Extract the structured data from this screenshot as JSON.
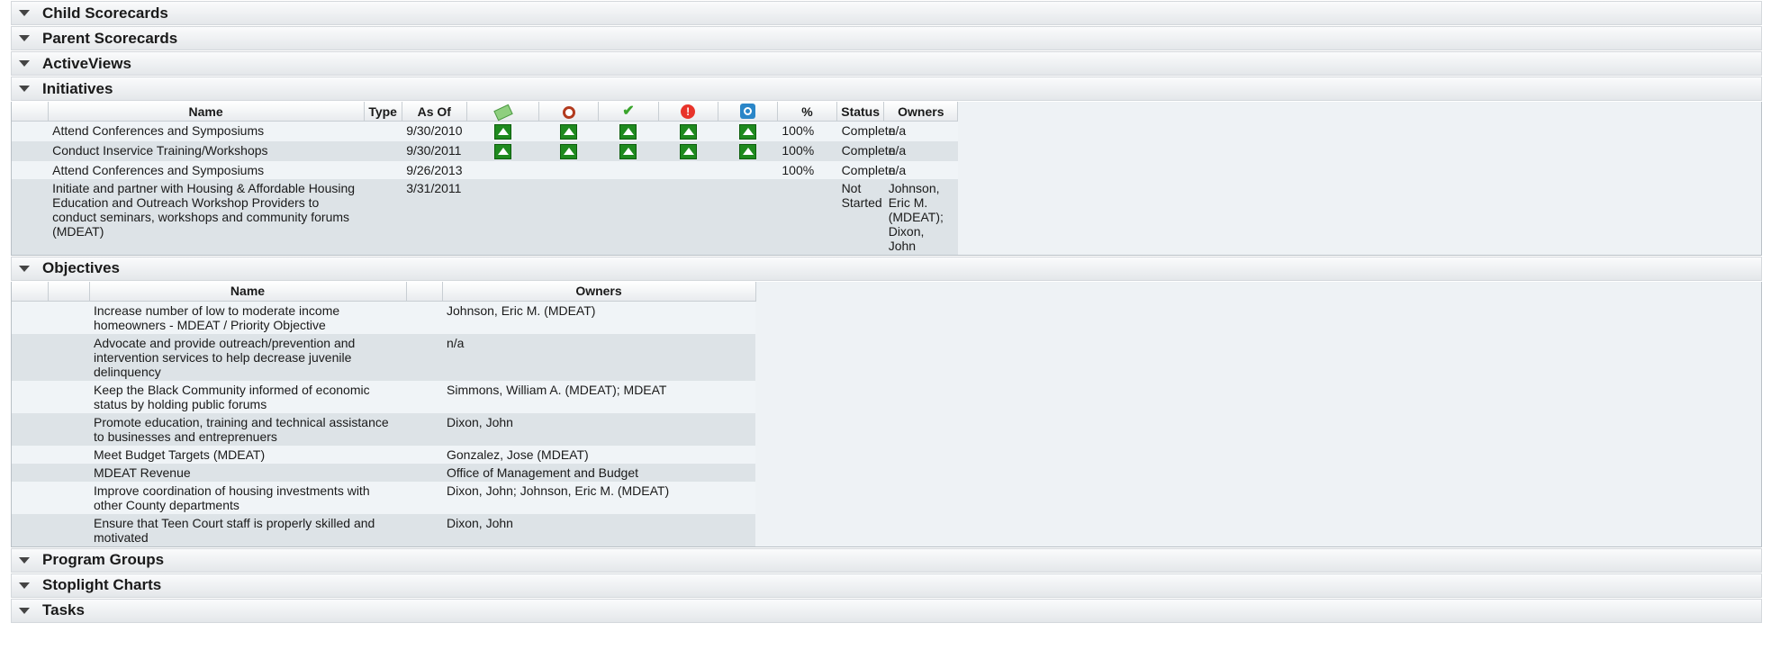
{
  "sections": {
    "child_scorecards": "Child Scorecards",
    "parent_scorecards": "Parent Scorecards",
    "activeviews": "ActiveViews",
    "initiatives": "Initiatives",
    "objectives": "Objectives",
    "program_groups": "Program Groups",
    "stoplight_charts": "Stoplight Charts",
    "tasks": "Tasks"
  },
  "initiatives": {
    "headers": {
      "name": "Name",
      "type": "Type",
      "as_of": "As Of",
      "percent": "%",
      "status": "Status",
      "owners": "Owners"
    },
    "header_icons": [
      "money-icon",
      "alarm-clock-icon",
      "checkmark-icon",
      "alert-icon",
      "target-icon"
    ],
    "rows": [
      {
        "name": "Attend Conferences and Symposiums",
        "as_of": "9/30/2010",
        "arrows": 5,
        "percent": "100%",
        "status": "Complete",
        "owners": "n/a"
      },
      {
        "name": "Conduct Inservice Training/Workshops",
        "as_of": "9/30/2011",
        "arrows": 5,
        "percent": "100%",
        "status": "Complete",
        "owners": "n/a"
      },
      {
        "name": "Attend Conferences and Symposiums",
        "as_of": "9/26/2013",
        "arrows": 0,
        "percent": "100%",
        "status": "Complete",
        "owners": "n/a"
      },
      {
        "name": "Initiate and partner with Housing & Affordable Housing Education and Outreach Workshop Providers to conduct seminars, workshops and community forums (MDEAT)",
        "as_of": "3/31/2011",
        "arrows": 0,
        "percent": "",
        "status": "Not Started",
        "owners": "Johnson, Eric M. (MDEAT); Dixon, John"
      }
    ]
  },
  "objectives": {
    "headers": {
      "name": "Name",
      "owners": "Owners"
    },
    "rows": [
      {
        "name": "Increase number of low to moderate income homeowners - MDEAT / Priority Objective",
        "owners": "Johnson, Eric M. (MDEAT)"
      },
      {
        "name": "Advocate and provide outreach/prevention and intervention services to help decrease juvenile delinquency",
        "owners": "n/a"
      },
      {
        "name": "Keep the Black Community informed of economic status by holding public forums",
        "owners": "Simmons, William  A. (MDEAT); MDEAT"
      },
      {
        "name": "Promote education, training and technical assistance to businesses and entreprenuers",
        "owners": "Dixon, John"
      },
      {
        "name": "Meet Budget Targets (MDEAT)",
        "owners": "Gonzalez, Jose (MDEAT)"
      },
      {
        "name": "MDEAT Revenue",
        "owners": "Office of Management and Budget"
      },
      {
        "name": "Improve coordination of housing investments with other County departments",
        "owners": "Dixon, John; Johnson, Eric M. (MDEAT)"
      },
      {
        "name": "Ensure that Teen Court staff is properly skilled and motivated",
        "owners": "Dixon, John"
      }
    ]
  },
  "colors": {
    "arrow_green": "#1f8a1f",
    "row_light": "#f0f4f7",
    "row_dark": "#dde3e7"
  }
}
